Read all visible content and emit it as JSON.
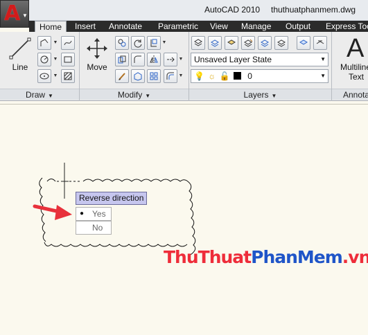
{
  "title": {
    "app": "AutoCAD 2010",
    "file": "thuthuatphanmem.dwg"
  },
  "tabs": [
    {
      "label": "Home"
    },
    {
      "label": "Insert"
    },
    {
      "label": "Annotate"
    },
    {
      "label": "Parametric"
    },
    {
      "label": "View"
    },
    {
      "label": "Manage"
    },
    {
      "label": "Output"
    },
    {
      "label": "Express Tools"
    }
  ],
  "ribbon": {
    "draw": {
      "line_label": "Line",
      "panel": "Draw"
    },
    "modify": {
      "move_label": "Move",
      "panel": "Modify"
    },
    "layers": {
      "layer_state": "Unsaved Layer State",
      "current_layer": "0",
      "panel": "Layers"
    },
    "annotation": {
      "multiline_label": "Multiline",
      "text_label": "Text",
      "panel": "Annotation"
    }
  },
  "dynamic_prompt": {
    "title": "Reverse direction",
    "options": [
      {
        "label": "Yes",
        "selected": true
      },
      {
        "label": "No",
        "selected": false
      }
    ],
    "bullet": "●"
  },
  "watermark": {
    "part1": "ThuThuat",
    "part2": "PhanMem",
    "part3": ".vn"
  },
  "colors": {
    "accent_red": "#ee2d3a",
    "accent_blue": "#1f55c8",
    "canvas": "#fbf9ee",
    "prompt_bg": "#c6c6ee"
  }
}
